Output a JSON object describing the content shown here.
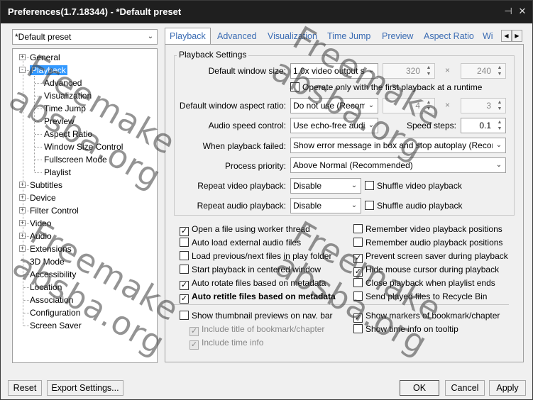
{
  "window": {
    "title": "Preferences(1.7.18344) - *Default preset"
  },
  "preset": {
    "value": "*Default preset"
  },
  "tree": [
    {
      "label": "General",
      "level": 0,
      "expander": "+"
    },
    {
      "label": "Playback",
      "level": 0,
      "expander": "-",
      "selected": true
    },
    {
      "label": "Advanced",
      "level": 1
    },
    {
      "label": "Visualization",
      "level": 1
    },
    {
      "label": "Time Jump",
      "level": 1
    },
    {
      "label": "Preview",
      "level": 1
    },
    {
      "label": "Aspect Ratio",
      "level": 1
    },
    {
      "label": "Window Size Control",
      "level": 1
    },
    {
      "label": "Fullscreen Mode",
      "level": 1
    },
    {
      "label": "Playlist",
      "level": 1
    },
    {
      "label": "Subtitles",
      "level": 0,
      "expander": "+"
    },
    {
      "label": "Device",
      "level": 0,
      "expander": "+"
    },
    {
      "label": "Filter Control",
      "level": 0,
      "expander": "+"
    },
    {
      "label": "Video",
      "level": 0,
      "expander": "+"
    },
    {
      "label": "Audio",
      "level": 0,
      "expander": "+"
    },
    {
      "label": "Extensions",
      "level": 0,
      "expander": "+"
    },
    {
      "label": "3D Mode",
      "level": 0
    },
    {
      "label": "Accessibility",
      "level": 0
    },
    {
      "label": "Location",
      "level": 0
    },
    {
      "label": "Association",
      "level": 0
    },
    {
      "label": "Configuration",
      "level": 0
    },
    {
      "label": "Screen Saver",
      "level": 0
    }
  ],
  "tabs": [
    "Playback",
    "Advanced",
    "Visualization",
    "Time Jump",
    "Preview",
    "Aspect Ratio",
    "Wi"
  ],
  "settings": {
    "group_title": "Playback Settings",
    "default_window_size": {
      "label": "Default window size:",
      "value": "1.0x video output s",
      "width": "320",
      "height": "240"
    },
    "operate_first": "Operate only with the first playback at a runtime",
    "aspect_ratio": {
      "label": "Default window aspect ratio:",
      "value": "Do not use (Recom",
      "w": "4",
      "h": "3"
    },
    "audio_speed": {
      "label": "Audio speed control:",
      "value": "Use echo-free audi",
      "steps_label": "Speed steps:",
      "steps": "0.1"
    },
    "playback_failed": {
      "label": "When playback failed:",
      "value": "Show error message in box and stop autoplay (Recom"
    },
    "priority": {
      "label": "Process priority:",
      "value": "Above Normal (Recommended)"
    },
    "repeat_video": {
      "label": "Repeat video playback:",
      "value": "Disable",
      "shuffle": "Shuffle video playback"
    },
    "repeat_audio": {
      "label": "Repeat audio playback:",
      "value": "Disable",
      "shuffle": "Shuffle audio playback"
    }
  },
  "checks_left": [
    {
      "label": "Open a file using worker thread",
      "checked": true
    },
    {
      "label": "Auto load external audio files",
      "checked": false
    },
    {
      "label": "Load previous/next files in play folder",
      "checked": false
    },
    {
      "label": "Start playback in centered window",
      "checked": false
    },
    {
      "label": "Auto rotate files based on metadata",
      "checked": true
    },
    {
      "label": "Auto retitle files based on metadata",
      "checked": true,
      "bold": true
    }
  ],
  "checks_right": [
    {
      "label": "Remember video playback positions",
      "checked": false
    },
    {
      "label": "Remember audio playback positions",
      "checked": false
    },
    {
      "label": "Prevent screen saver during playback",
      "checked": true
    },
    {
      "label": "Hide mouse cursor during playback",
      "checked": true
    },
    {
      "label": "Close playback when playlist ends",
      "checked": false
    },
    {
      "label": "Send played files to Recycle Bin",
      "checked": false
    }
  ],
  "thumbs": {
    "show_thumbnail": "Show thumbnail previews on nav. bar",
    "include_title": "Include title of bookmark/chapter",
    "include_time": "Include time info",
    "show_markers": "Show markers of bookmark/chapter",
    "show_time": "Show time info on tooltip"
  },
  "buttons": {
    "reset": "Reset",
    "export": "Export Settings...",
    "ok": "OK",
    "cancel": "Cancel",
    "apply": "Apply"
  },
  "watermark": [
    "Freemake",
    "absba.org"
  ]
}
